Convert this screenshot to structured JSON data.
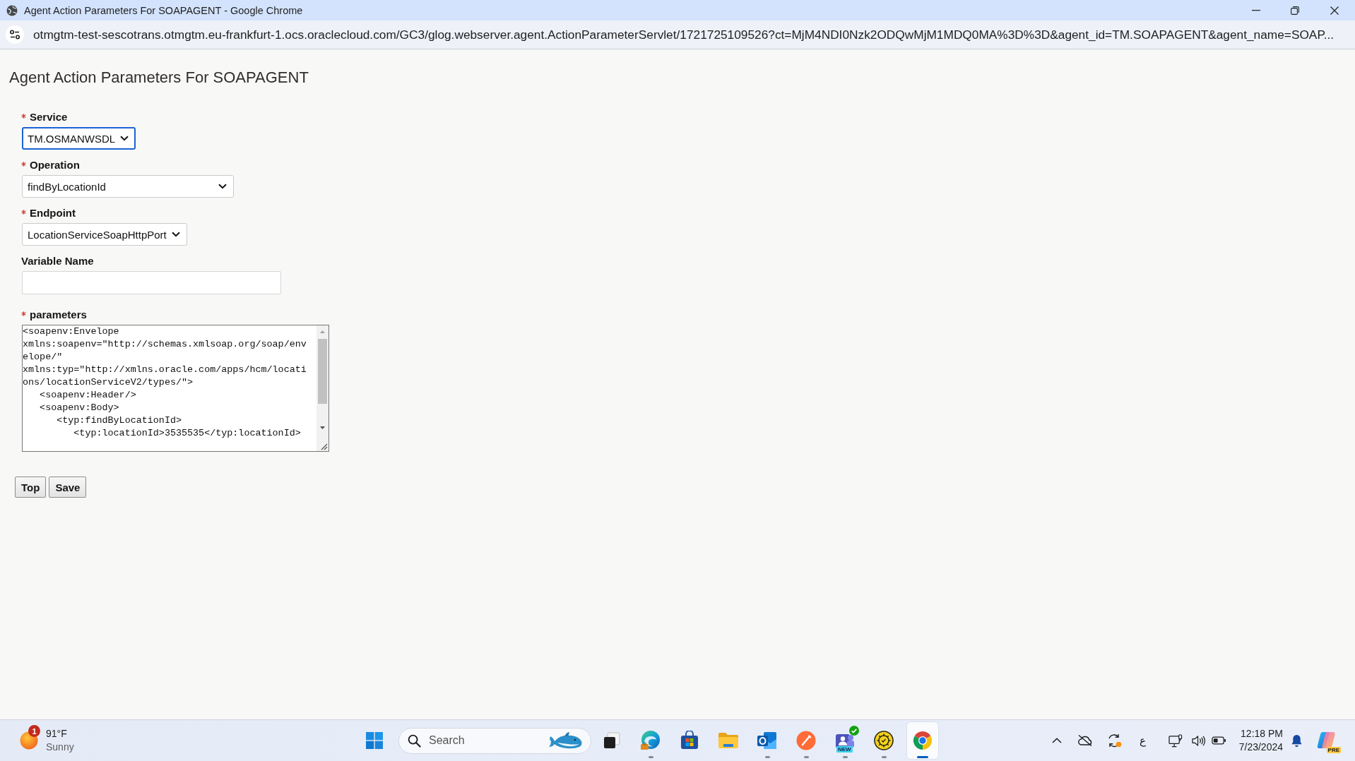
{
  "window": {
    "title": "Agent Action Parameters For SOAPAGENT - Google Chrome"
  },
  "address_bar": {
    "url": "otmgtm-test-sescotrans.otmgtm.eu-frankfurt-1.ocs.oraclecloud.com/GC3/glog.webserver.agent.ActionParameterServlet/1721725109526?ct=MjM4NDI0Nzk2ODQwMjM1MDQ0MA%3D%3D&agent_id=TM.SOAPAGENT&agent_name=SOAP..."
  },
  "page": {
    "heading": "Agent Action Parameters For SOAPAGENT",
    "fields": [
      {
        "kind": "select",
        "label": "Service",
        "required": true,
        "value": "TM.OSMANWSDL",
        "focused": true
      },
      {
        "kind": "select",
        "label": "Operation",
        "required": true,
        "value": "findByLocationId",
        "focused": false
      },
      {
        "kind": "select",
        "label": "Endpoint",
        "required": true,
        "value": "LocationServiceSoapHttpPort",
        "focused": false
      },
      {
        "kind": "text",
        "label": "Variable Name",
        "required": false,
        "focused": false
      },
      {
        "kind": "textarea",
        "label": "parameters",
        "required": true,
        "focused": false,
        "value": "<soapenv:Envelope\nxmlns:soapenv=\"http://schemas.xmlsoap.org/soap/envelope/\"\nxmlns:typ=\"http://xmlns.oracle.com/apps/hcm/locations/locationServiceV2/types/\">\n   <soapenv:Header/>\n   <soapenv:Body>\n      <typ:findByLocationId>\n         <typ:locationId>3535535</typ:locationId>"
      }
    ],
    "buttons": [
      "Top",
      "Save"
    ]
  },
  "taskbar": {
    "weather": {
      "alert_count": "1",
      "temperature": "91°F",
      "condition": "Sunny"
    },
    "search": {
      "placeholder": "Search"
    },
    "apps": [
      {
        "kind": "task-view",
        "running": false,
        "selected": false
      },
      {
        "kind": "swirl",
        "running": true,
        "selected": false
      },
      {
        "kind": "store",
        "running": false,
        "selected": false
      },
      {
        "kind": "folder",
        "running": false,
        "selected": false
      },
      {
        "kind": "mail",
        "running": true,
        "selected": false
      },
      {
        "kind": "pen",
        "running": true,
        "selected": false
      },
      {
        "kind": "people",
        "running": true,
        "selected": false,
        "tag": "NEW"
      },
      {
        "kind": "gear",
        "running": true,
        "selected": false
      },
      {
        "kind": "browser",
        "running": true,
        "selected": true
      }
    ],
    "tray": {
      "language": "ع",
      "time": "12:18 PM",
      "date": "7/23/2024"
    },
    "copilot": {
      "tag": "PRE"
    }
  }
}
